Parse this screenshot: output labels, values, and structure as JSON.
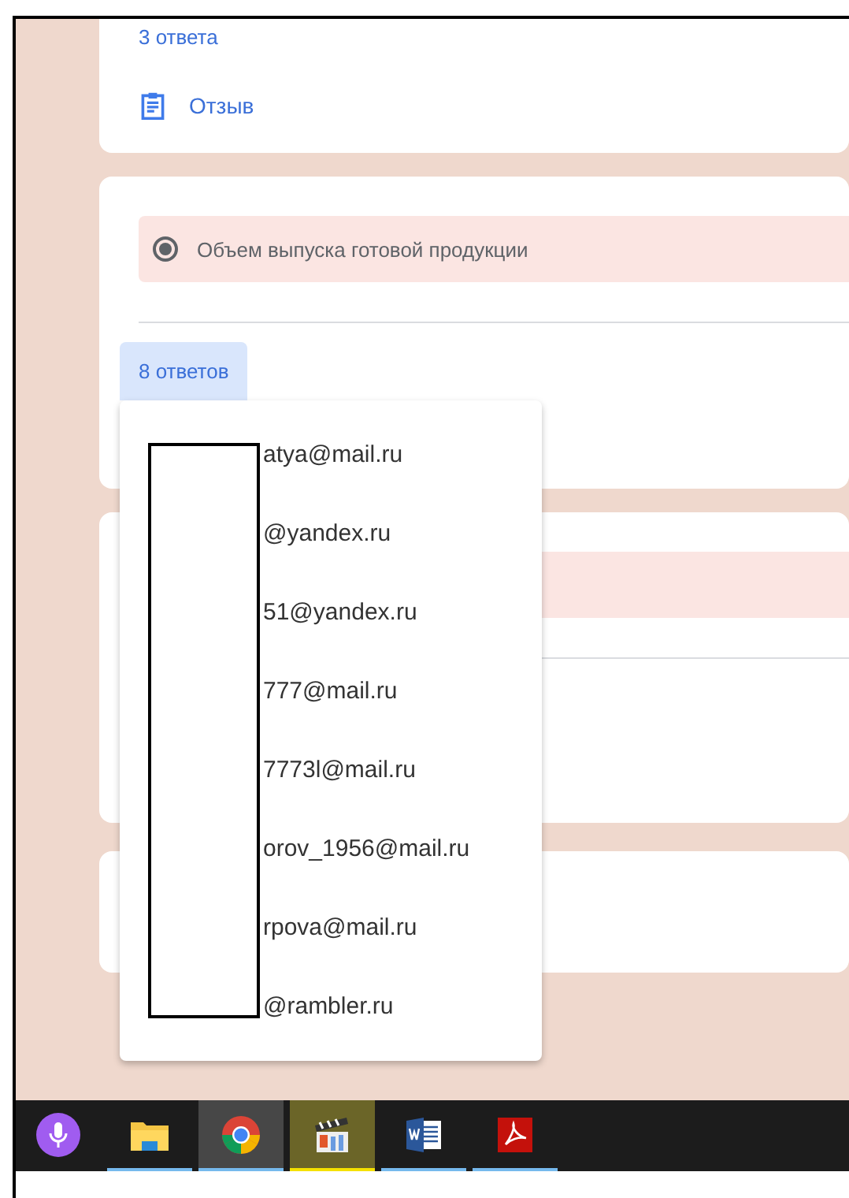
{
  "summary_card": {
    "responses_link": "3 ответа",
    "feedback_link": "Отзыв"
  },
  "question_card": {
    "option": {
      "label": "Объем выпуска готовой продукции",
      "selected": true
    },
    "responses_button": "8 ответов"
  },
  "responses_menu": {
    "items": [
      {
        "email": "atya@mail.ru"
      },
      {
        "email": "@yandex.ru"
      },
      {
        "email": "51@yandex.ru"
      },
      {
        "email": "777@mail.ru"
      },
      {
        "email": "7773l@mail.ru"
      },
      {
        "email": "orov_1956@mail.ru"
      },
      {
        "email": "rpova@mail.ru"
      },
      {
        "email": "@rambler.ru"
      }
    ]
  },
  "taskbar": {
    "apps": [
      {
        "kind": "mic",
        "running": false,
        "selected": false,
        "flashing": false
      },
      {
        "kind": "folder",
        "running": true,
        "selected": false,
        "flashing": false
      },
      {
        "kind": "browser",
        "running": true,
        "selected": true,
        "flashing": false
      },
      {
        "kind": "clapper",
        "running": false,
        "selected": false,
        "flashing": true
      },
      {
        "kind": "word",
        "running": true,
        "selected": false,
        "flashing": false
      },
      {
        "kind": "pdf",
        "running": true,
        "selected": false,
        "flashing": false
      }
    ]
  }
}
